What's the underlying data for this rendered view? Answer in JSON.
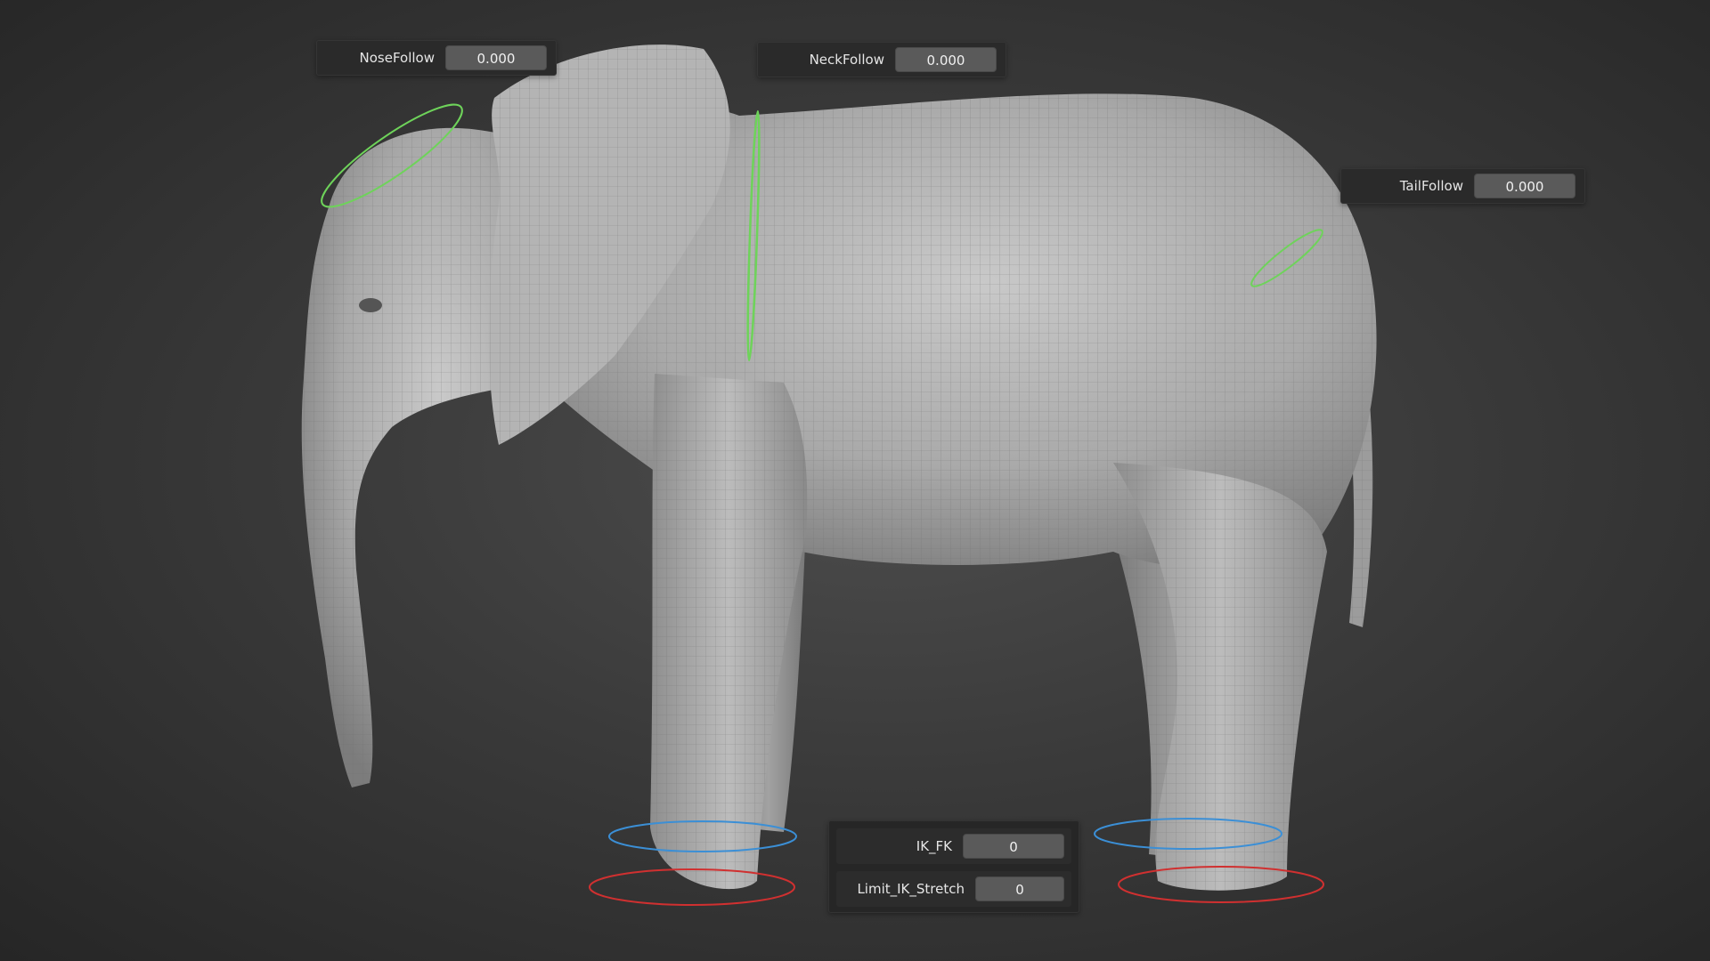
{
  "viewport": {
    "background": "#3a3a3a",
    "mesh_color": "#b8b8b8",
    "controls": {
      "head_control_color": "#6ed35a",
      "neck_control_color": "#6ed35a",
      "tail_control_color": "#6ed35a",
      "ik_ring_color": "#3b8fd6",
      "foot_ring_color": "#d03030"
    }
  },
  "properties": {
    "nose_follow": {
      "label": "NoseFollow",
      "value": "0.000"
    },
    "neck_follow": {
      "label": "NeckFollow",
      "value": "0.000"
    },
    "tail_follow": {
      "label": "TailFollow",
      "value": "0.000"
    },
    "ik_fk": {
      "label": "IK_FK",
      "value": "0"
    },
    "limit_ik_stretch": {
      "label": "Limit_IK_Stretch",
      "value": "0"
    }
  }
}
